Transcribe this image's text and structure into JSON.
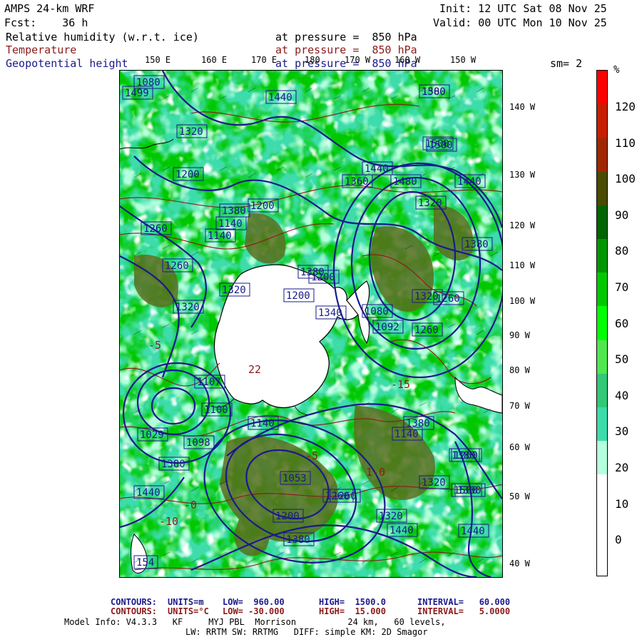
{
  "header": {
    "model": "AMPS 24-km WRF",
    "fcst": "Fcst:    36 h",
    "init": "Init: 12 UTC Sat 08 Nov 25",
    "valid": "Valid: 00 UTC Mon 10 Nov 25",
    "fields": [
      {
        "name": "Relative humidity (w.r.t. ice)",
        "level": "at pressure =  850 hPa"
      },
      {
        "name": "Temperature",
        "level": "at pressure =  850 hPa"
      },
      {
        "name": "Geopotential height",
        "level": "at pressure =  850 hPa"
      }
    ],
    "smoothing": "sm= 2"
  },
  "colors": {
    "height_contour": "#1a1a8b",
    "temp_contour": "#8b1a1a",
    "continent": "#ffffff",
    "ocean_dry": "#ffffff"
  },
  "lon_labels": [
    "150 E",
    "160 E",
    "170 E",
    "180",
    "170 W",
    "160 W",
    "150 W"
  ],
  "lat_labels": [
    "140 W",
    "130 W",
    "120 W",
    "110 W",
    "100 W",
    "90 W",
    "80 W",
    "70 W",
    "60 W",
    "50 W",
    "40 W"
  ],
  "colorbar": {
    "unit": "%",
    "ticks": [
      "120",
      "110",
      "100",
      "90",
      "80",
      "70",
      "60",
      "50",
      "40",
      "30",
      "20",
      "10",
      "0"
    ],
    "colors": [
      "#ff0000",
      "#c81e00",
      "#a02800",
      "#4b4b00",
      "#006400",
      "#009600",
      "#00c800",
      "#00ff00",
      "#50e650",
      "#32c878",
      "#3cdcaa",
      "#b4ffdc",
      "#ffffff",
      "#ffffff",
      "#ffffff"
    ]
  },
  "map_labels": {
    "heights": [
      "1499",
      "1440",
      "1380",
      "1320",
      "1200",
      "1260",
      "1140",
      "1200",
      "1360",
      "1480",
      "1320",
      "1500",
      "1440",
      "1380",
      "1320",
      "1260",
      "1200",
      "1140",
      "1080",
      "1029",
      "1053",
      "1098",
      "1260",
      "1380",
      "1440",
      "1320",
      "1260",
      "1500",
      "1440",
      "1380",
      "1320",
      "1260",
      "1200",
      "1140",
      "1080",
      "1380",
      "1500",
      "1440",
      "1320",
      "1340",
      "1107",
      "1260",
      "1200",
      "1380",
      "1320",
      "1140",
      "1100",
      "1092",
      "1300",
      "1260",
      "1380",
      "1500",
      "1440",
      "1380",
      "154"
    ],
    "temps": [
      "22",
      "-5",
      "-10",
      "-0",
      "-15",
      "1-0",
      "-5"
    ]
  },
  "footer": {
    "line1": {
      "label": "CONTOURS:",
      "units": "UNITS=m",
      "low": "LOW=  960.00",
      "high": "HIGH=  1500.0",
      "interval": "INTERVAL=   60.000"
    },
    "line2": {
      "label": "CONTOURS:",
      "units": "UNITS=°C",
      "low": "LOW= -30.000",
      "high": "HIGH=  15.000",
      "interval": "INTERVAL=   5.0000"
    },
    "model_info": "Model Info: V4.3.3   KF     MYJ PBL  Morrison          24 km,   60 levels,",
    "model_info2": "LW: RRTM SW: RRTMG   DIFF: simple KM: 2D Smagor"
  }
}
